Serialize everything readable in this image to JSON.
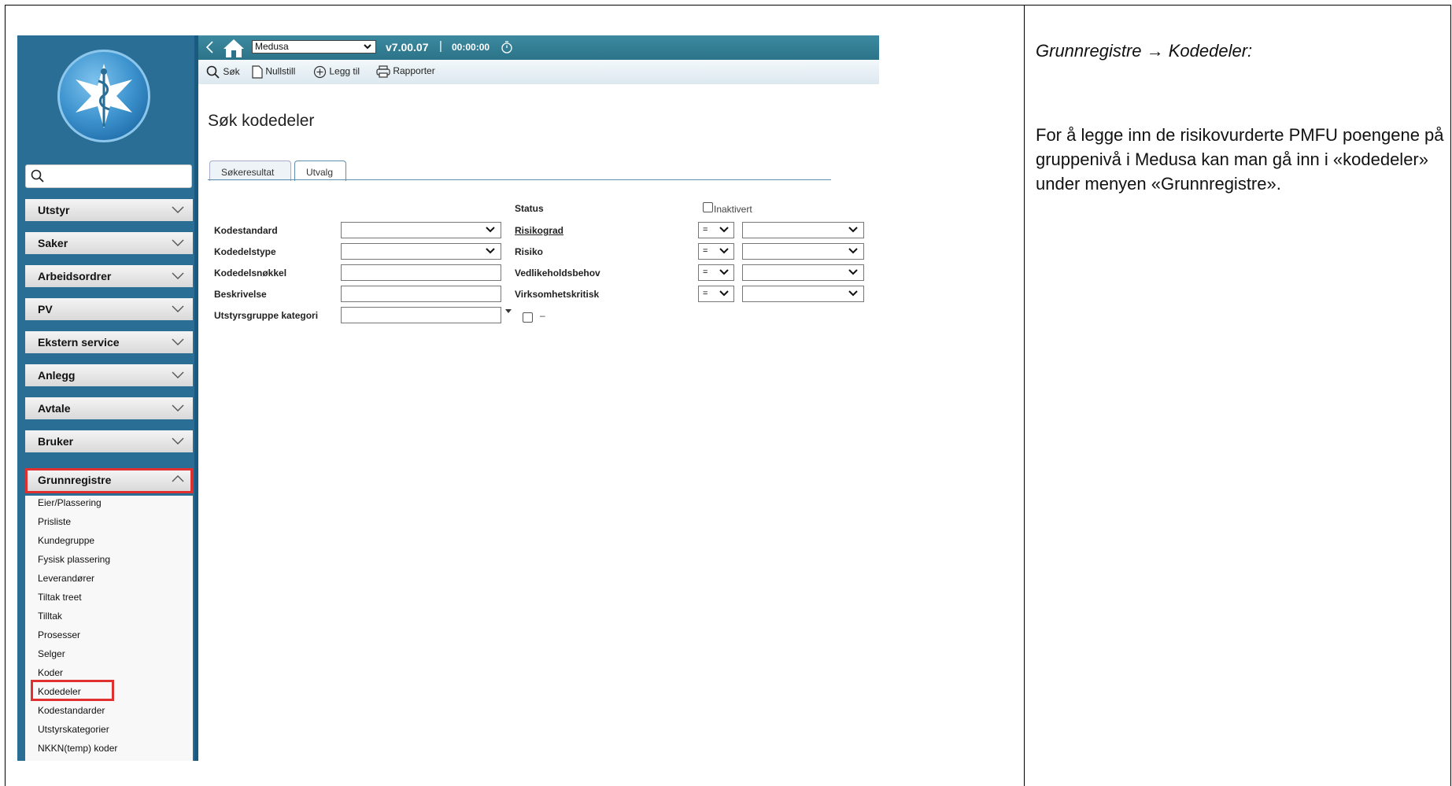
{
  "app": {
    "selected_module": "Medusa",
    "version": "v7.00.07",
    "separator": "|",
    "timer": "00:00:00"
  },
  "toolbar": {
    "search_label": "Søk",
    "reset_label": "Nullstill",
    "add_label": "Legg til",
    "reports_label": "Rapporter"
  },
  "sidebar": {
    "menu": [
      {
        "label": "Utstyr"
      },
      {
        "label": "Saker"
      },
      {
        "label": "Arbeidsordrer"
      },
      {
        "label": "PV"
      },
      {
        "label": "Ekstern service"
      },
      {
        "label": "Anlegg"
      },
      {
        "label": "Avtale"
      },
      {
        "label": "Bruker"
      },
      {
        "label": "Grunnregistre"
      }
    ],
    "submenu": [
      "Eier/Plassering",
      "Prisliste",
      "Kundegruppe",
      "Fysisk plassering",
      "Leverandører",
      "Tiltak treet",
      "Tilltak",
      "Prosesser",
      "Selger",
      "Koder",
      "Kodedeler",
      "Kodestandarder",
      "Utstyrskategorier",
      "NKKN(temp) koder"
    ]
  },
  "page": {
    "title": "Søk kodedeler",
    "tabs": [
      "Søkeresultat",
      "Utvalg"
    ]
  },
  "form": {
    "status_label": "Status",
    "inactive_label": "Inaktivert",
    "left_fields": [
      "Kodestandard",
      "Kodedelstype",
      "Kodedelsnøkkel",
      "Beskrivelse",
      "Utstyrsgruppe kategori"
    ],
    "right_fields": [
      "Risikograd",
      "Risiko",
      "Vedlikeholdsbehov",
      "Virksomhetskritisk"
    ],
    "operator": "=",
    "dash": "–"
  },
  "instructions": {
    "title": "Grunnregistre → Kodedeler:",
    "body": "For å legge inn de risikovurderte PMFU poengene på gruppenivå i Medusa kan man gå inn i «kodedeler» under menyen «Grunnregistre»."
  }
}
